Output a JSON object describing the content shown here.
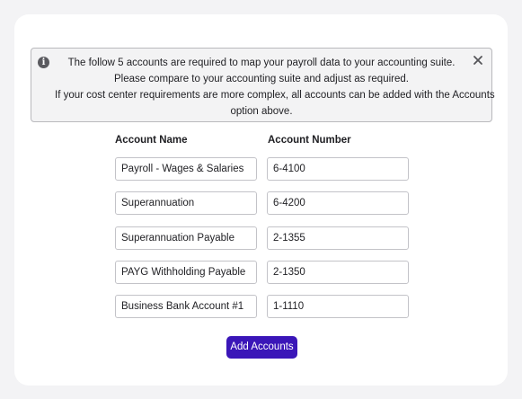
{
  "notice": {
    "lines": [
      "The follow 5 accounts are required to map your payroll data to your accounting suite.",
      "Please compare to your accounting suite and adjust as required.",
      "If your cost center requirements are more complex, all accounts can be added with the Accounts",
      "option above."
    ],
    "info_icon": "info-icon",
    "close_icon": "close-icon"
  },
  "columns": {
    "name": "Account Name",
    "number": "Account Number"
  },
  "accounts": [
    {
      "name": "Payroll - Wages & Salaries",
      "number": "6-4100"
    },
    {
      "name": "Superannuation",
      "number": "6-4200"
    },
    {
      "name": "Superannuation Payable",
      "number": "2-1355"
    },
    {
      "name": "PAYG Withholding Payable",
      "number": "2-1350"
    },
    {
      "name": "Business Bank Account #1",
      "number": "1-1110"
    }
  ],
  "add_button_label": "Add Accounts",
  "colors": {
    "accent": "#3a16b8",
    "background": "#f3f3f5",
    "notice_bg": "#f3f3f4"
  }
}
